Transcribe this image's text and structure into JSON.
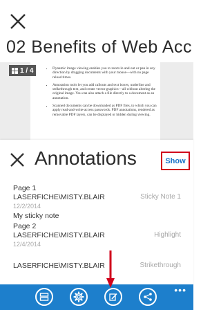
{
  "document": {
    "title": "02 Benefits of Web Acc",
    "page_indicator": "1 / 4",
    "preview_bullets": [
      "Dynamic image viewing enables you to zoom in and out or pan in any direction by dragging documents with your mouse—with no page reload times.",
      "Annotation tools let you add callouts and text boxes, underline and strikethrough text, and create vector graphics—all without altering the original image. You can also attach a file directly to a document as an annotation.",
      "Scanned documents can be downloaded as PDF files, to which you can apply read-and-write-access passwords. PDF annotations, rendered as removable PDF layers, can be displayed or hidden during viewing."
    ]
  },
  "annotations_panel": {
    "title": "Annotations",
    "show_label": "Show",
    "items": [
      {
        "page": "Page 1",
        "author": "LASERFICHE\\MISTY.BLAIR",
        "type": "Sticky Note 1",
        "date": "12/2/2014",
        "note": "My sticky note"
      },
      {
        "page": "Page 2",
        "author": "LASERFICHE\\MISTY.BLAIR",
        "type": "Highlight",
        "date": "12/4/2014",
        "note": ""
      },
      {
        "page": "",
        "author": "LASERFICHE\\MISTY.BLAIR",
        "type": "Strikethrough",
        "date": "",
        "note": ""
      }
    ]
  },
  "app_bar": {
    "buttons": [
      "stack-icon",
      "gear-icon",
      "edit-icon",
      "share-icon"
    ],
    "more_label": "•••",
    "background": "#1d7fcc"
  },
  "colors": {
    "highlight_box": "#d0021b",
    "link_blue": "#1a73c8",
    "arrow_red": "#d0021b"
  }
}
